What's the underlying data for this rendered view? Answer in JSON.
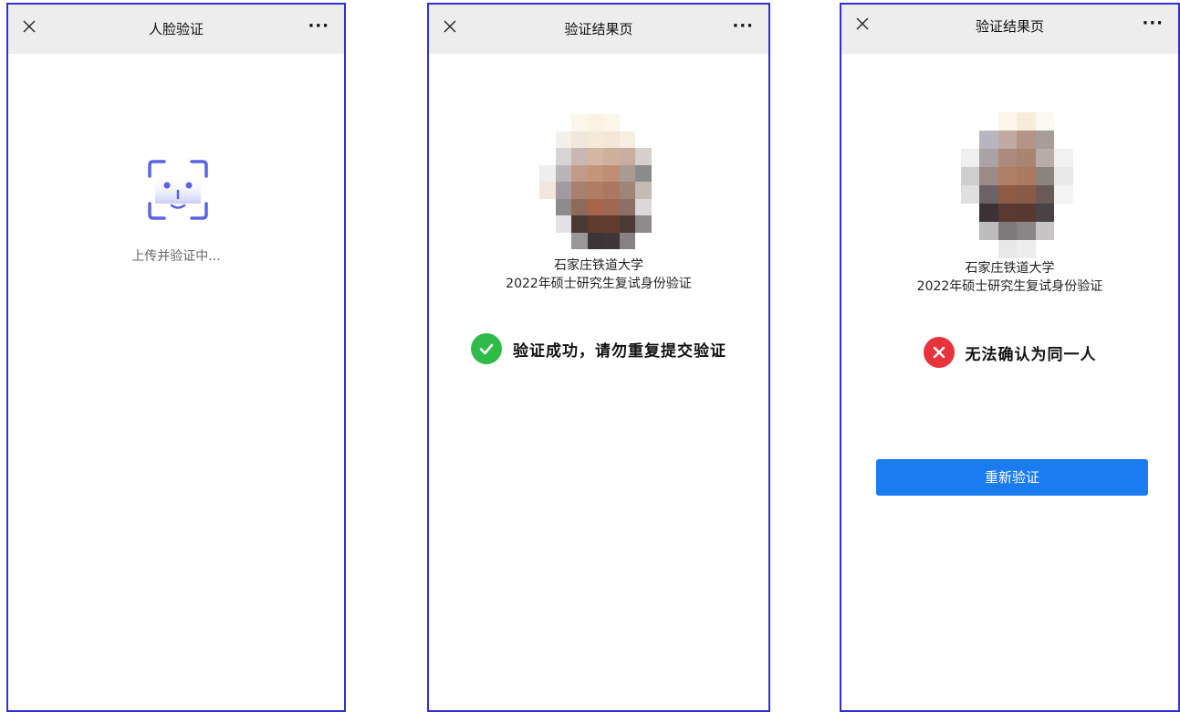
{
  "screens": [
    {
      "title": "人脸验证",
      "status": "上传并验证中..."
    },
    {
      "title": "验证结果页",
      "university": "石家庄铁道大学",
      "subtitle": "2022年硕士研究生复试身份验证",
      "result_message": "验证成功，请勿重复提交验证"
    },
    {
      "title": "验证结果页",
      "university": "石家庄铁道大学",
      "subtitle": "2022年硕士研究生复试身份验证",
      "result_message": "无法确认为同一人",
      "retry_label": "重新验证"
    }
  ],
  "icons": {
    "close": "close-icon",
    "more": "more-icon",
    "face_scan": "face-scan-icon",
    "success": "check-circle-icon",
    "failure": "x-circle-icon"
  },
  "colors": {
    "border": "#2f2fd6",
    "topbar": "#ededed",
    "success": "#2ebb4a",
    "failure": "#e8323c",
    "primary_button": "#1a7cf0",
    "face_icon": "#5a63e6"
  }
}
